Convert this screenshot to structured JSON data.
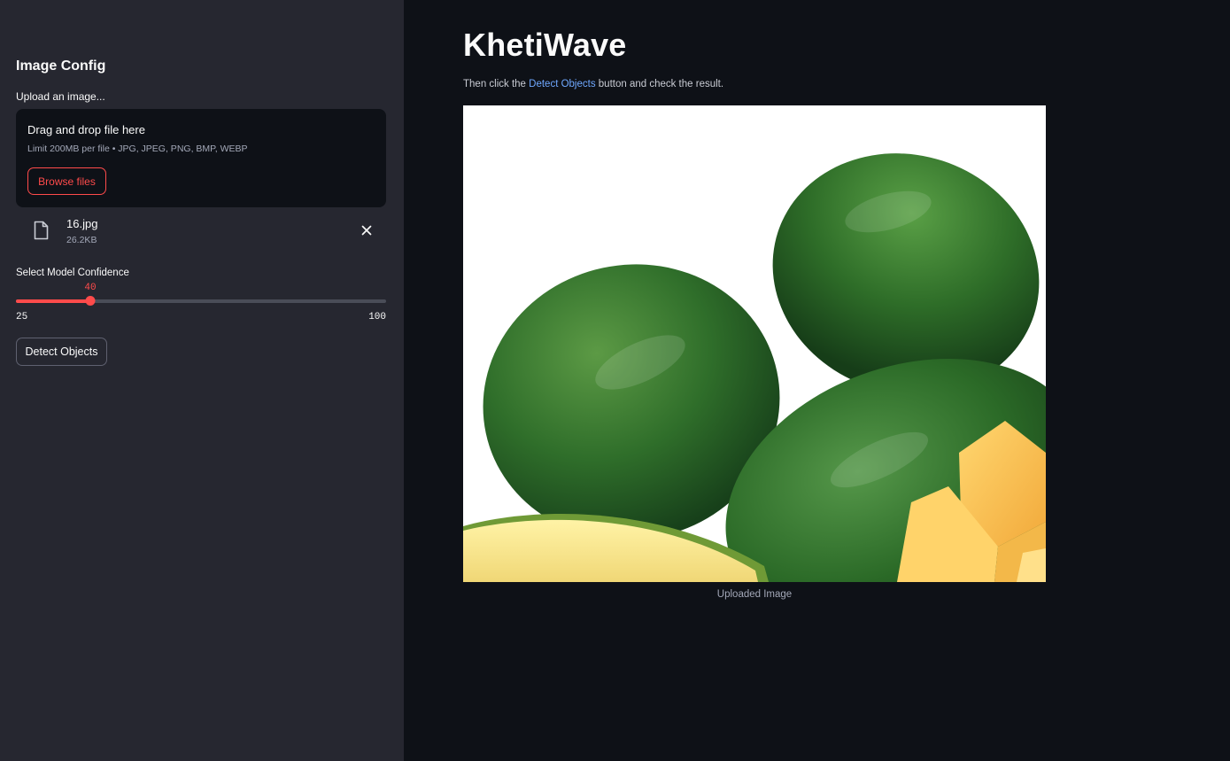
{
  "sidebar": {
    "heading": "Image Config",
    "upload_label": "Upload an image...",
    "dropzone": {
      "title": "Drag and drop file here",
      "limit": "Limit 200MB per file • JPG, JPEG, PNG, BMP, WEBP",
      "browse_label": "Browse files"
    },
    "file": {
      "name": "16.jpg",
      "size": "26.2KB",
      "icon": "file-icon",
      "remove_icon": "close-icon"
    },
    "confidence": {
      "label": "Select Model Confidence",
      "value": 40,
      "value_text": "40",
      "min": 25,
      "min_text": "25",
      "max": 100,
      "max_text": "100"
    },
    "detect_label": "Detect Objects"
  },
  "main": {
    "title": "KhetiWave",
    "instruction_prefix": "Then click the ",
    "instruction_link": "Detect Objects",
    "instruction_suffix": " button and check the result.",
    "image_caption": "Uploaded Image"
  },
  "colors": {
    "accent": "#ff4b4b",
    "link": "#6fa8ff",
    "sidebar_bg": "#262730",
    "main_bg": "#0e1117"
  }
}
